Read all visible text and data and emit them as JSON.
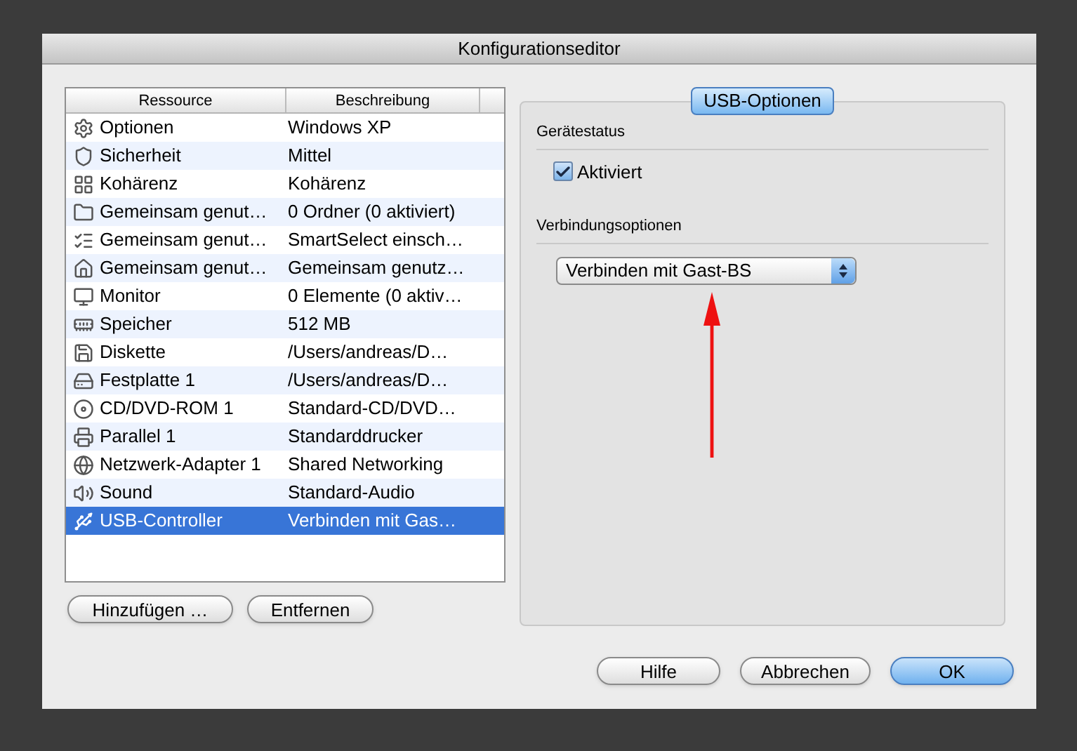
{
  "window": {
    "title": "Konfigurationseditor"
  },
  "table": {
    "columns": [
      "Ressource",
      "Beschreibung"
    ],
    "rows": [
      {
        "kind": "options",
        "resource": "Optionen",
        "description": "Windows XP",
        "selected": false
      },
      {
        "kind": "security",
        "resource": "Sicherheit",
        "description": "Mittel",
        "selected": false
      },
      {
        "kind": "coherence",
        "resource": "Kohärenz",
        "description": "Kohärenz",
        "selected": false
      },
      {
        "kind": "folder",
        "resource": "Gemeinsam genut…",
        "description": "0 Ordner (0 aktiviert)",
        "selected": false
      },
      {
        "kind": "list",
        "resource": "Gemeinsam genut…",
        "description": "SmartSelect einsch…",
        "selected": false
      },
      {
        "kind": "home",
        "resource": "Gemeinsam genut…",
        "description": "Gemeinsam genutz…",
        "selected": false
      },
      {
        "kind": "monitor",
        "resource": "Monitor",
        "description": "0 Elemente (0 aktiv…",
        "selected": false
      },
      {
        "kind": "memory",
        "resource": "Speicher",
        "description": "512 MB",
        "selected": false
      },
      {
        "kind": "floppy",
        "resource": "Diskette",
        "description": "/Users/andreas/D…",
        "selected": false
      },
      {
        "kind": "disk",
        "resource": "Festplatte 1",
        "description": "/Users/andreas/D…",
        "selected": false
      },
      {
        "kind": "cd",
        "resource": "CD/DVD-ROM 1",
        "description": "Standard-CD/DVD…",
        "selected": false
      },
      {
        "kind": "printer",
        "resource": "Parallel 1",
        "description": "Standarddrucker",
        "selected": false
      },
      {
        "kind": "network",
        "resource": "Netzwerk-Adapter 1",
        "description": "Shared Networking",
        "selected": false
      },
      {
        "kind": "sound",
        "resource": "Sound",
        "description": "Standard-Audio",
        "selected": false
      },
      {
        "kind": "usb",
        "resource": "USB-Controller",
        "description": "Verbinden mit Gas…",
        "selected": true
      }
    ]
  },
  "list_buttons": [
    "Hinzufügen …",
    "Entfernen"
  ],
  "panel": {
    "tab": "USB-Optionen",
    "device_status": {
      "heading": "Gerätestatus",
      "checkbox": {
        "label": "Aktiviert",
        "checked": true
      }
    },
    "connection": {
      "heading": "Verbindungsoptionen",
      "select_value": "Verbinden mit Gast-BS"
    }
  },
  "buttons": [
    {
      "label": "Hilfe",
      "default": false
    },
    {
      "label": "Abbrechen",
      "default": false
    },
    {
      "label": "OK",
      "default": true
    }
  ]
}
